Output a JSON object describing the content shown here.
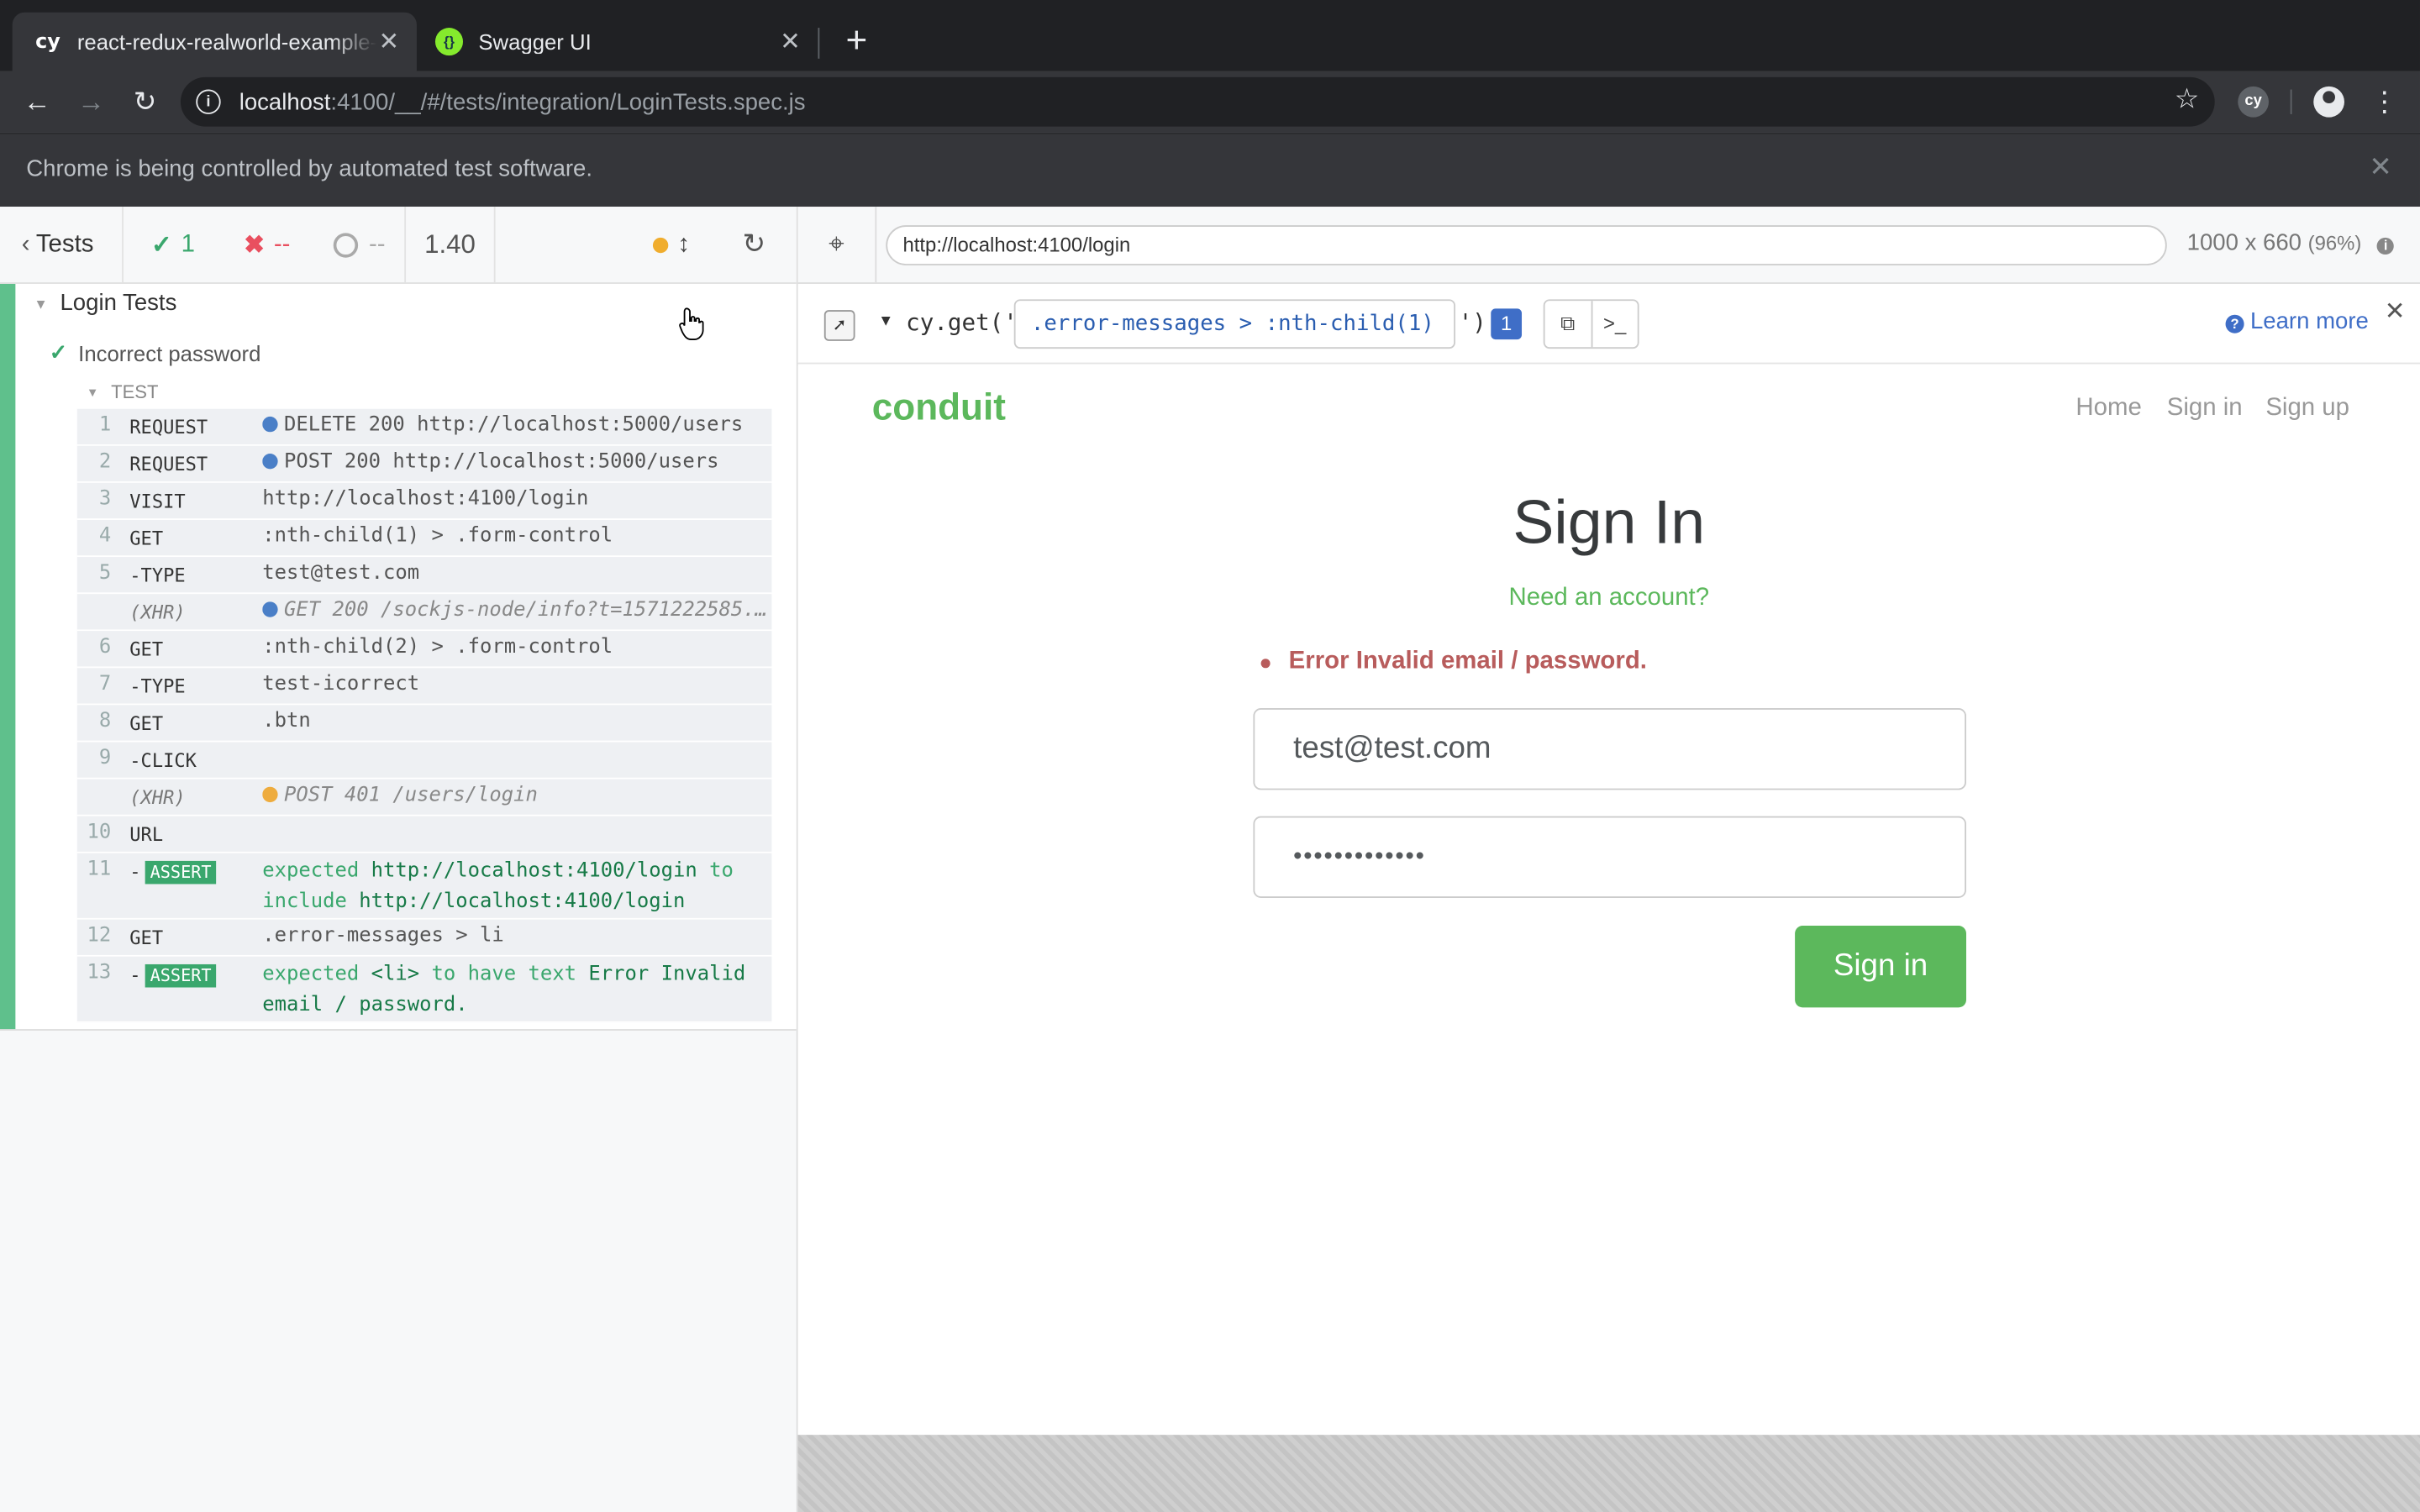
{
  "browser": {
    "tabs": [
      {
        "favicon": "cy",
        "title": "react-redux-realworld-example-app"
      },
      {
        "favicon": "swagger-icon",
        "title": "Swagger UI"
      }
    ],
    "address": {
      "host": "localhost",
      "rest": ":4100/__/#/tests/integration/LoginTests.spec.js"
    },
    "infobar_text": "Chrome is being controlled by automated test software.",
    "extension_label": "cy"
  },
  "reporter": {
    "tests_label": "Tests",
    "passed": "1",
    "failed": "--",
    "pending": "--",
    "duration": "1.40",
    "suite_title": "Login Tests",
    "test_title": "Incorrect password",
    "hook_label": "TEST",
    "commands": [
      {
        "num": "1",
        "name": "REQUEST",
        "msg": "DELETE 200 http://localhost:5000/users"
      },
      {
        "num": "2",
        "name": "REQUEST",
        "msg": "POST 200 http://localhost:5000/users"
      },
      {
        "num": "3",
        "name": "VISIT",
        "msg": "http://localhost:4100/login"
      },
      {
        "num": "4",
        "name": "GET",
        "msg": ":nth-child(1) > .form-control"
      },
      {
        "num": "5",
        "name": "-TYPE",
        "msg": "test@test.com"
      },
      {
        "num": "",
        "name": "(XHR)",
        "msg": "GET 200 /sockjs-node/info?t=1571222585..."
      },
      {
        "num": "6",
        "name": "GET",
        "msg": ":nth-child(2) > .form-control"
      },
      {
        "num": "7",
        "name": "-TYPE",
        "msg": "test-icorrect"
      },
      {
        "num": "8",
        "name": "GET",
        "msg": ".btn"
      },
      {
        "num": "9",
        "name": "-CLICK",
        "msg": ""
      },
      {
        "num": "",
        "name": "(XHR)",
        "msg": "POST 401 /users/login"
      },
      {
        "num": "10",
        "name": "URL",
        "msg": ""
      },
      {
        "num": "11",
        "name": "ASSERT",
        "w1": "expected",
        "v1": "http://localhost:4100/login",
        "w2": "to",
        "w3": "include",
        "v2": "http://localhost:4100/login"
      },
      {
        "num": "12",
        "name": "GET",
        "msg": ".error-messages > li"
      },
      {
        "num": "13",
        "name": "ASSERT",
        "w1": "expected",
        "v1": "<li>",
        "w2": "to have text",
        "v2": "Error Invalid",
        "v3": "email / password."
      }
    ]
  },
  "aut": {
    "url": "http://localhost:4100/login",
    "viewport": "1000 x 660",
    "scale": "(96%)",
    "playground": {
      "prefix": "cy.get('",
      "selector": ".error-messages > :nth-child(1)",
      "suffix": "')",
      "count": "1",
      "learn_more": "Learn more"
    }
  },
  "app": {
    "brand": "conduit",
    "nav": [
      "Home",
      "Sign in",
      "Sign up"
    ],
    "heading": "Sign In",
    "need_account": "Need an account?",
    "error": "Error Invalid email / password.",
    "email_value": "test@test.com",
    "password_value": "•••••••••••••",
    "submit": "Sign in"
  },
  "colors": {
    "pass": "#5fc08c",
    "fail": "#e94f5f",
    "brand": "#5cb85c",
    "error": "#b85c5c",
    "accent": "#3f6ec7"
  }
}
